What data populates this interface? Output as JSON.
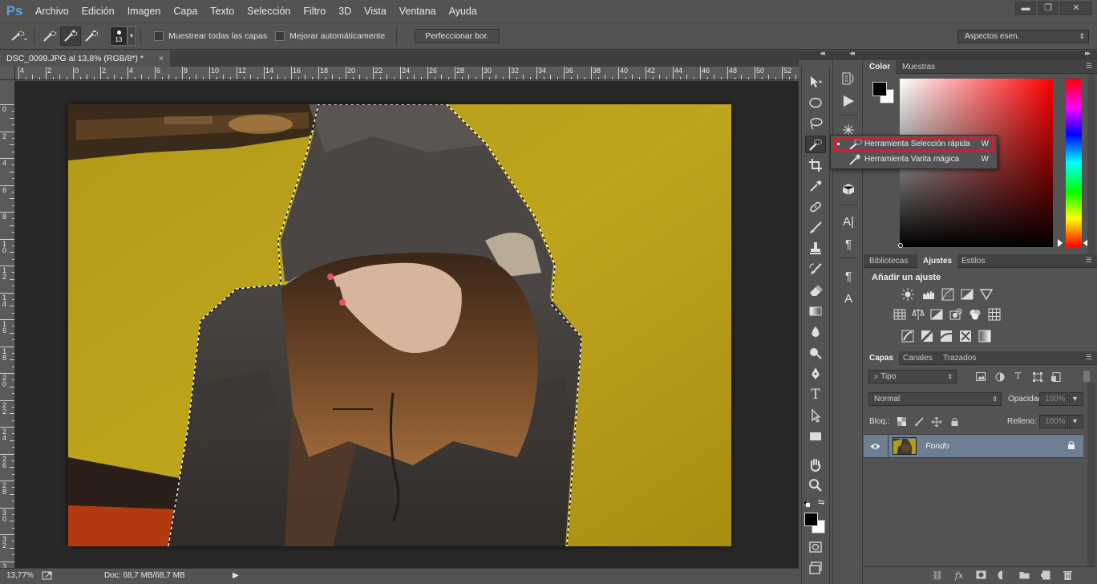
{
  "app": {
    "logo": "Ps"
  },
  "menu": [
    "Archivo",
    "Edición",
    "Imagen",
    "Capa",
    "Texto",
    "Selección",
    "Filtro",
    "3D",
    "Vista",
    "Ventana",
    "Ayuda"
  ],
  "window_controls": {
    "minimize": "▬",
    "restore": "❐",
    "close": "✕"
  },
  "options_bar": {
    "brush_size": "13",
    "sample_all_layers": "Muestrear todas las capas",
    "auto_enhance": "Mejorar automáticamente",
    "refine_edge": "Perfeccionar bor.",
    "workspace": "Aspectos esen."
  },
  "document": {
    "tab_title": "DSC_0099.JPG al 13,8% (RGB/8*) *",
    "tab_close": "×"
  },
  "rulers": {
    "top": [
      "4",
      "2",
      "0",
      "2",
      "4",
      "6",
      "8",
      "10",
      "12",
      "14",
      "16",
      "18",
      "20",
      "22",
      "24",
      "26",
      "28",
      "30",
      "32",
      "34",
      "36",
      "38",
      "40",
      "42",
      "44",
      "46",
      "48",
      "50",
      "52",
      "54"
    ],
    "left": [
      "0",
      "2",
      "4",
      "6",
      "8",
      "1 0",
      "1 2",
      "1 4",
      "1 6",
      "1 8",
      "2 0",
      "2 2",
      "2 4",
      "2 6",
      "2 8",
      "3 0",
      "3 2",
      "3 4"
    ]
  },
  "status": {
    "zoom": "13,77%",
    "doc_info": "Doc: 68,7 MB/68,7 MB",
    "arrow": "▶"
  },
  "tools": [
    {
      "name": "move"
    },
    {
      "name": "marquee"
    },
    {
      "name": "lasso"
    },
    {
      "name": "quick-selection",
      "active": true
    },
    {
      "name": "crop"
    },
    {
      "name": "eyedropper"
    },
    {
      "name": "healing"
    },
    {
      "name": "brush"
    },
    {
      "name": "stamp"
    },
    {
      "name": "history-brush"
    },
    {
      "name": "eraser"
    },
    {
      "name": "gradient"
    },
    {
      "name": "blur"
    },
    {
      "name": "dodge"
    },
    {
      "name": "pen"
    },
    {
      "name": "type"
    },
    {
      "name": "path-selection"
    },
    {
      "name": "shape"
    },
    {
      "name": "hand"
    },
    {
      "name": "zoom"
    }
  ],
  "type_tool_glyph": "T",
  "flyout": {
    "items": [
      {
        "label": "Herramienta Selección rápida",
        "key": "W"
      },
      {
        "label": "Herramienta Varita mágica",
        "key": "W"
      }
    ]
  },
  "mini_strip": {
    "char_a": "A|",
    "pilcrow": "¶",
    "pilcrow2": "¶",
    "char_a2": "A"
  },
  "color_panel": {
    "tabs": [
      "Color",
      "Muestras"
    ],
    "fg": "#000000",
    "bg": "#ffffff",
    "hue": "#ff0000"
  },
  "adjust_panel": {
    "tabs": [
      "Bibliotecas",
      "Ajustes",
      "Estilos"
    ],
    "title": "Añadir un ajuste"
  },
  "layers_panel": {
    "tabs": [
      "Capas",
      "Canales",
      "Trazados"
    ],
    "filter": "Tipo",
    "blend_mode": "Normal",
    "opacity_label": "Opacidad:",
    "opacity_value": "100%",
    "lock_label": "Bloq.:",
    "fill_label": "Relleno:",
    "fill_value": "100%",
    "layers": [
      {
        "name": "Fondo",
        "locked": true
      }
    ],
    "footer_fx": "fx"
  },
  "colors": {
    "highlight": "#e4162a",
    "selected_layer": "#6f7e93",
    "wall": "#b9a21a"
  }
}
